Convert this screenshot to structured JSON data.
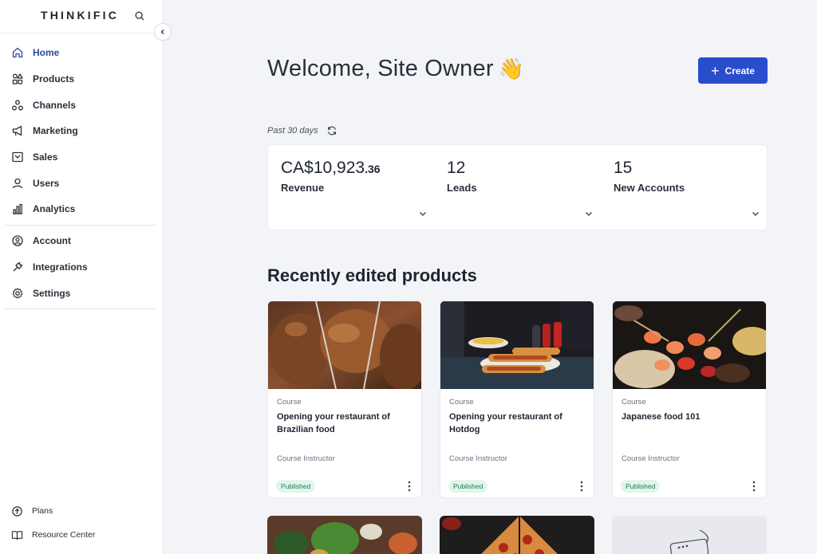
{
  "brand": {
    "name": "THINKIFIC"
  },
  "sidebar": {
    "items": [
      {
        "label": "Home",
        "icon": "home-icon",
        "active": true
      },
      {
        "label": "Products",
        "icon": "products-icon"
      },
      {
        "label": "Channels",
        "icon": "channels-icon"
      },
      {
        "label": "Marketing",
        "icon": "megaphone-icon"
      },
      {
        "label": "Sales",
        "icon": "sales-icon"
      },
      {
        "label": "Users",
        "icon": "user-icon"
      },
      {
        "label": "Analytics",
        "icon": "bar-chart-icon"
      }
    ],
    "items2": [
      {
        "label": "Account",
        "icon": "account-circle-icon"
      },
      {
        "label": "Integrations",
        "icon": "plug-icon"
      },
      {
        "label": "Settings",
        "icon": "gear-icon"
      }
    ],
    "bottom": [
      {
        "label": "Plans",
        "icon": "arrow-up-circle-icon"
      },
      {
        "label": "Resource Center",
        "icon": "book-icon"
      }
    ]
  },
  "main": {
    "welcome": "Welcome, Site Owner",
    "wave_emoji": "👋",
    "create_label": "Create",
    "period_label": "Past 30 days",
    "stats": [
      {
        "value_main": "CA$10,923",
        "value_cents": ".36",
        "label": "Revenue"
      },
      {
        "value_main": "12",
        "value_cents": "",
        "label": "Leads"
      },
      {
        "value_main": "15",
        "value_cents": "",
        "label": "New Accounts"
      }
    ],
    "section_title": "Recently edited products",
    "products": [
      {
        "type": "Course",
        "title": "Opening your restaurant of Brazilian food",
        "instructor": "Course Instructor",
        "status": "Published"
      },
      {
        "type": "Course",
        "title": "Opening your restaurant of Hotdog",
        "instructor": "Course Instructor",
        "status": "Published"
      },
      {
        "type": "Course",
        "title": "Japanese food 101",
        "instructor": "Course Instructor",
        "status": "Published"
      }
    ]
  },
  "colors": {
    "accent": "#2a4dcc",
    "active_nav": "#2c4a9e",
    "published_bg": "#e3f4ec",
    "published_text": "#1f7a4d",
    "background": "#f3f4f8"
  }
}
